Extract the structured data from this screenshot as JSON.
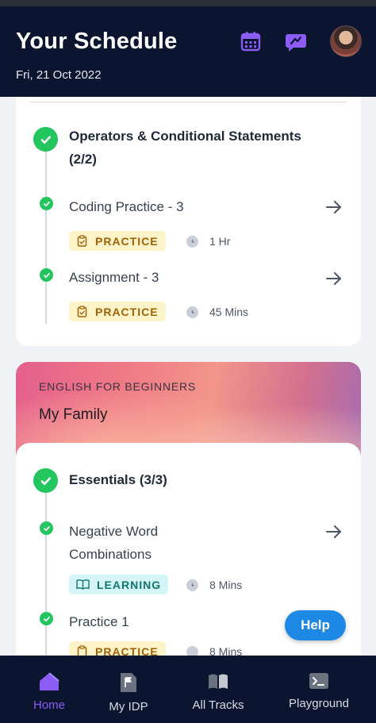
{
  "header": {
    "title": "Your Schedule",
    "date": "Fri, 21 Oct 2022",
    "icons": [
      "calendar-icon",
      "chat-icon",
      "avatar"
    ]
  },
  "section1": {
    "title": "Operators & Conditional Statements (2/2)",
    "items": [
      {
        "title": "Coding Practice - 3",
        "badge": "PRACTICE",
        "duration": "1 Hr"
      },
      {
        "title": "Assignment - 3",
        "badge": "PRACTICE",
        "duration": "45 Mins"
      }
    ]
  },
  "course": {
    "eyebrow": "ENGLISH FOR BEGINNERS",
    "name": "My Family"
  },
  "section2": {
    "title": "Essentials (3/3)",
    "items": [
      {
        "title": "Negative Word Combinations",
        "badge": "LEARNING",
        "duration": "8 Mins"
      },
      {
        "title": "Practice 1",
        "badge": "PRACTICE",
        "duration": "8 Mins"
      }
    ]
  },
  "help_label": "Help",
  "nav": {
    "items": [
      {
        "label": "Home",
        "icon": "home-icon",
        "active": true
      },
      {
        "label": "My IDP",
        "icon": "flag-doc-icon",
        "active": false
      },
      {
        "label": "All Tracks",
        "icon": "book-icon",
        "active": false
      },
      {
        "label": "Playground",
        "icon": "terminal-icon",
        "active": false
      }
    ]
  },
  "colors": {
    "header_bg": "#0b1530",
    "accent": "#8b5cf6",
    "success": "#22c55e",
    "help_button": "#1e88e5"
  }
}
